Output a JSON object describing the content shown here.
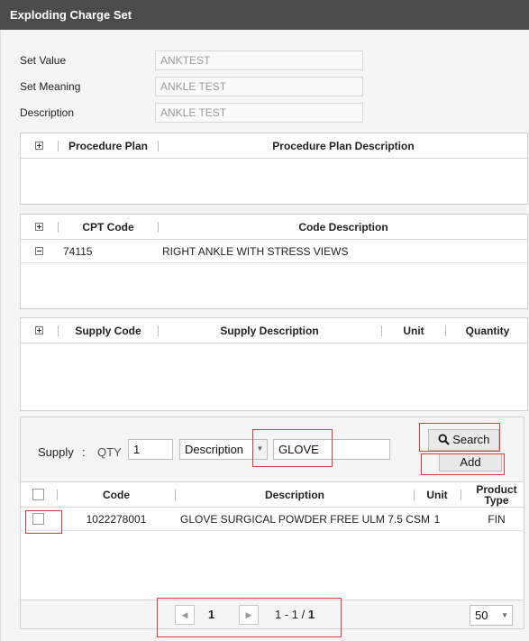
{
  "window": {
    "title": "Exploding Charge Set"
  },
  "fields": {
    "set_value": {
      "label": "Set Value",
      "value": "ANKTEST"
    },
    "set_meaning": {
      "label": "Set Meaning",
      "value": "ANKLE TEST"
    },
    "description": {
      "label": "Description",
      "value": "ANKLE TEST"
    }
  },
  "procedure_grid": {
    "col1": "Procedure Plan",
    "col2": "Procedure Plan Description"
  },
  "cpt_grid": {
    "col1": "CPT Code",
    "col2": "Code Description",
    "rows": [
      {
        "code": "74115",
        "description": "RIGHT ANKLE WITH STRESS VIEWS"
      }
    ]
  },
  "supply_grid": {
    "col1": "Supply Code",
    "col2": "Supply Description",
    "col3": "Unit",
    "col4": "Quantity"
  },
  "supply_panel": {
    "supply_label": "Supply",
    "colon": ":",
    "qty_label": "QTY",
    "qty_value": "1",
    "search_by": "Description",
    "search_value": "GLOVE",
    "search_button": "Search",
    "add_button": "Add"
  },
  "results_grid": {
    "col_code": "Code",
    "col_description": "Description",
    "col_unit": "Unit",
    "col_product_type": "Product Type",
    "rows": [
      {
        "code": "1022278001",
        "description": "GLOVE SURGICAL POWDER FREE ULM 7.5 CSM",
        "unit": "1",
        "product_type": "FIN"
      }
    ]
  },
  "pager": {
    "page": "1",
    "range_prefix": "1 - 1 /",
    "range_total": "1",
    "page_size": "50"
  }
}
